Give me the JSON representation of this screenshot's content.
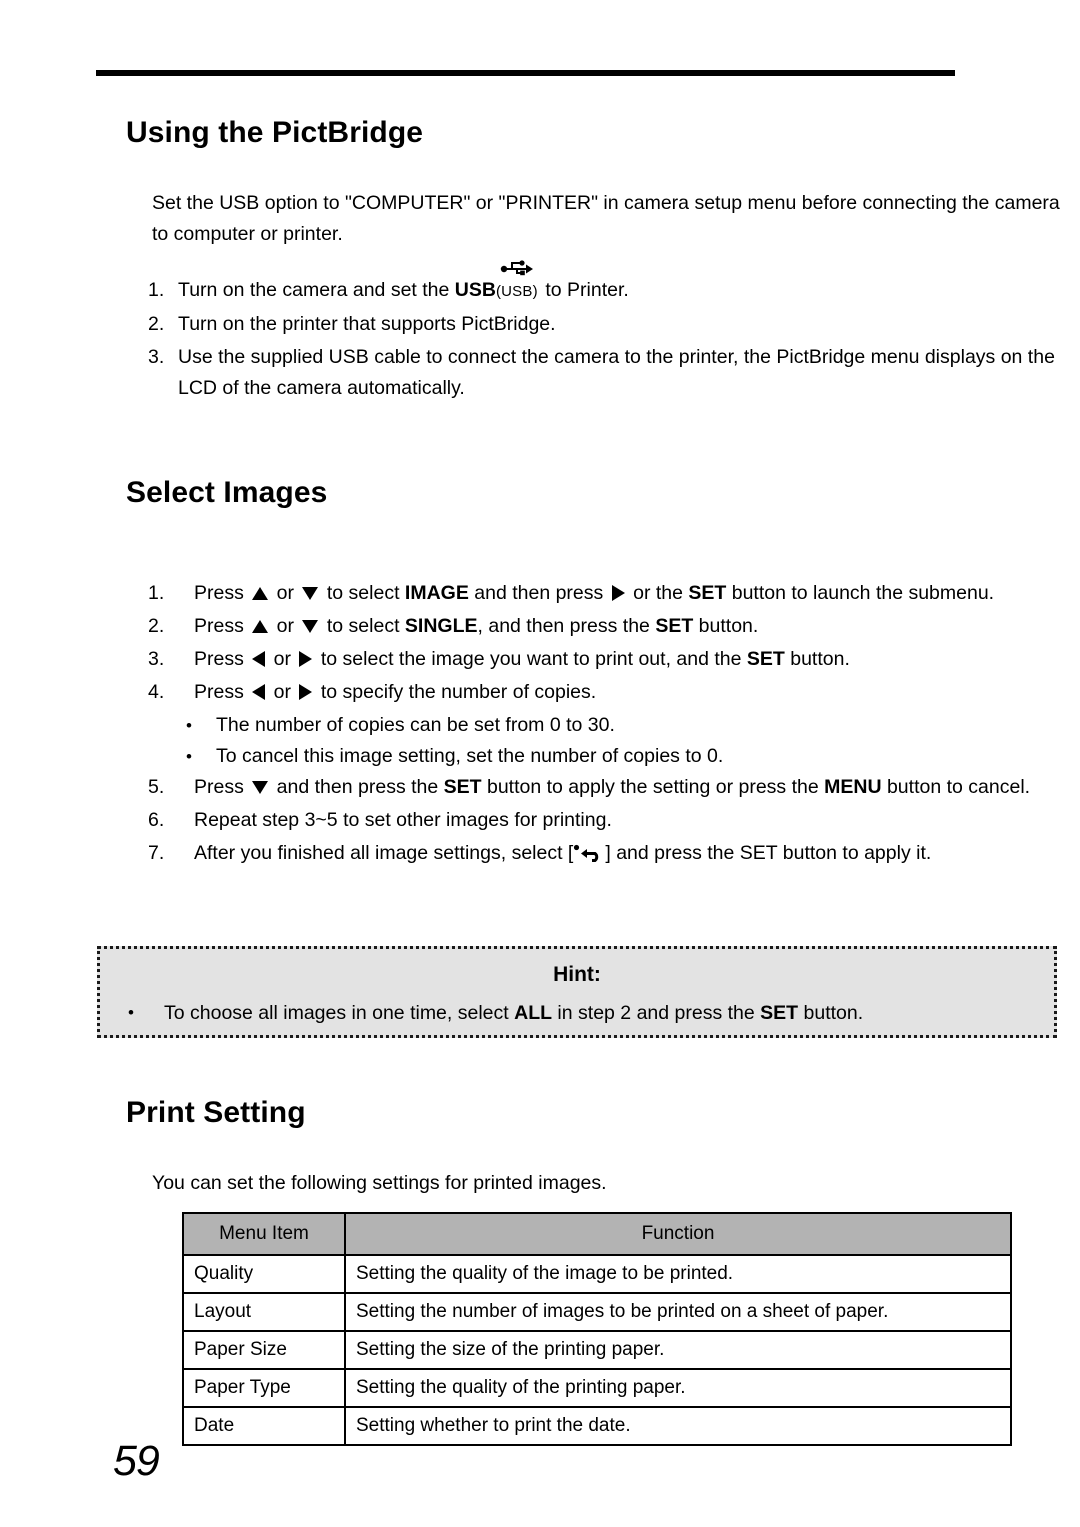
{
  "document": {
    "page_number": "59"
  },
  "pictbridge": {
    "heading": "Using the PictBridge",
    "intro": "Set the USB option to \"COMPUTER\" or \"PRINTER\" in camera setup menu before connecting the camera to computer or printer.",
    "steps": [
      {
        "num": "1.",
        "pre": "Turn on the camera and set the ",
        "bold": "USB",
        "icon_label": "(USB)",
        "icon": "usb-icon",
        "post": " to Printer."
      },
      {
        "num": "2.",
        "text": "Turn on the printer that supports PictBridge."
      },
      {
        "num": "3.",
        "text": "Use the supplied USB cable to connect the camera to the printer, the PictBridge menu displays on the LCD of the camera automatically."
      }
    ]
  },
  "select_images": {
    "heading": "Select Images",
    "steps": {
      "s1": {
        "num": "1.",
        "p1": "Press ",
        "p2": " or ",
        "p3": " to select ",
        "b1": "IMAGE",
        "p4": " and then press ",
        "p5": " or the ",
        "b2": "SET",
        "p6": " button to launch the submenu."
      },
      "s2": {
        "num": "2.",
        "p1": "Press ",
        "p2": " or ",
        "p3": " to select ",
        "b1": "SINGLE",
        "p4": ", and then press the ",
        "b2": "SET",
        "p5": " button."
      },
      "s3": {
        "num": "3.",
        "p1": "Press ",
        "p2": " or ",
        "p3": " to select the image you want to print out, and the ",
        "b1": "SET",
        "p4": " button."
      },
      "s4": {
        "num": "4.",
        "p1": "Press ",
        "p2": " or ",
        "p3": " to specify the number of copies."
      },
      "bullets": [
        "The number of copies can be set from 0 to 30.",
        "To cancel this image setting, set the number of copies to 0."
      ],
      "s5": {
        "num": "5.",
        "p1": "Press ",
        "p2": " and then press the ",
        "b1": "SET",
        "p3": " button to apply the setting or press the ",
        "b2": "MENU",
        "p4": " button to cancel."
      },
      "s6": {
        "num": "6.",
        "text": "Repeat step 3~5 to set other images for printing."
      },
      "s7": {
        "num": "7.",
        "p1": "After you finished all image settings, select [",
        "icon": "return-icon",
        "p2": "] and press the SET button to apply it."
      }
    }
  },
  "hint": {
    "title": "Hint:",
    "bullet_symbol": "•",
    "p1": "To choose all images in one time, select ",
    "b1": "ALL",
    "p2": " in step 2 and press the ",
    "b2": "SET",
    "p3": " button."
  },
  "print_setting": {
    "heading": "Print Setting",
    "intro": "You can set the following settings for printed images.",
    "table": {
      "headers": [
        "Menu Item",
        "Function"
      ],
      "rows": [
        [
          "Quality",
          "Setting the quality of the image to be printed."
        ],
        [
          "Layout",
          "Setting the number of images to be printed on a sheet of paper."
        ],
        [
          "Paper Size",
          "Setting the size of the printing paper."
        ],
        [
          "Paper Type",
          "Setting the quality of the printing paper."
        ],
        [
          "Date",
          "Setting whether to print the date."
        ]
      ]
    }
  },
  "colors": {
    "hint_background": "#e3e3e3",
    "table_header_background": "#b3b3b3",
    "rule": "#000000"
  }
}
